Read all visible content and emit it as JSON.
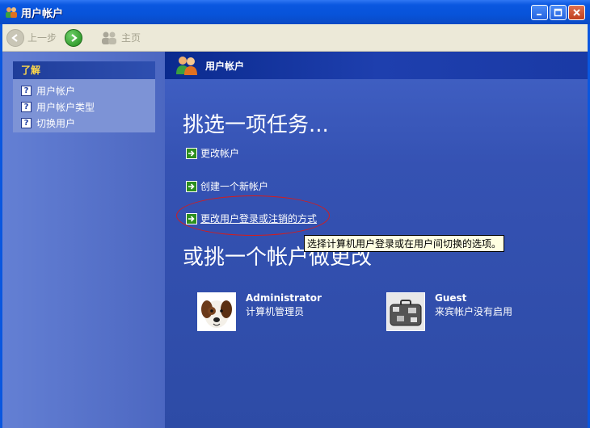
{
  "window": {
    "title": "用户帐户"
  },
  "toolbar": {
    "back_label": "上一步",
    "home_label": "主页"
  },
  "learn": {
    "header": "了解",
    "items": [
      {
        "label": "用户帐户",
        "icon": "help-icon"
      },
      {
        "label": "用户帐户类型",
        "icon": "help-icon"
      },
      {
        "label": "切换用户",
        "icon": "help-icon"
      }
    ]
  },
  "main": {
    "header_title": "用户帐户",
    "task_title": "挑选一项任务...",
    "tasks": [
      {
        "label": "更改帐户"
      },
      {
        "label": "创建一个新帐户"
      },
      {
        "label": "更改用户登录或注销的方式"
      }
    ],
    "tooltip": "选择计算机用户登录或在用户间切换的选项。",
    "account_title": "或挑一个帐户做更改",
    "accounts": [
      {
        "name": "Administrator",
        "desc": "计算机管理员"
      },
      {
        "name": "Guest",
        "desc": "来宾帐户没有启用"
      }
    ]
  },
  "colors": {
    "accent_green": "#2c8f1e",
    "title_blue": "#0753d9",
    "highlight_red": "#d41d1d",
    "learn_header_yellow": "#ffd84a"
  }
}
